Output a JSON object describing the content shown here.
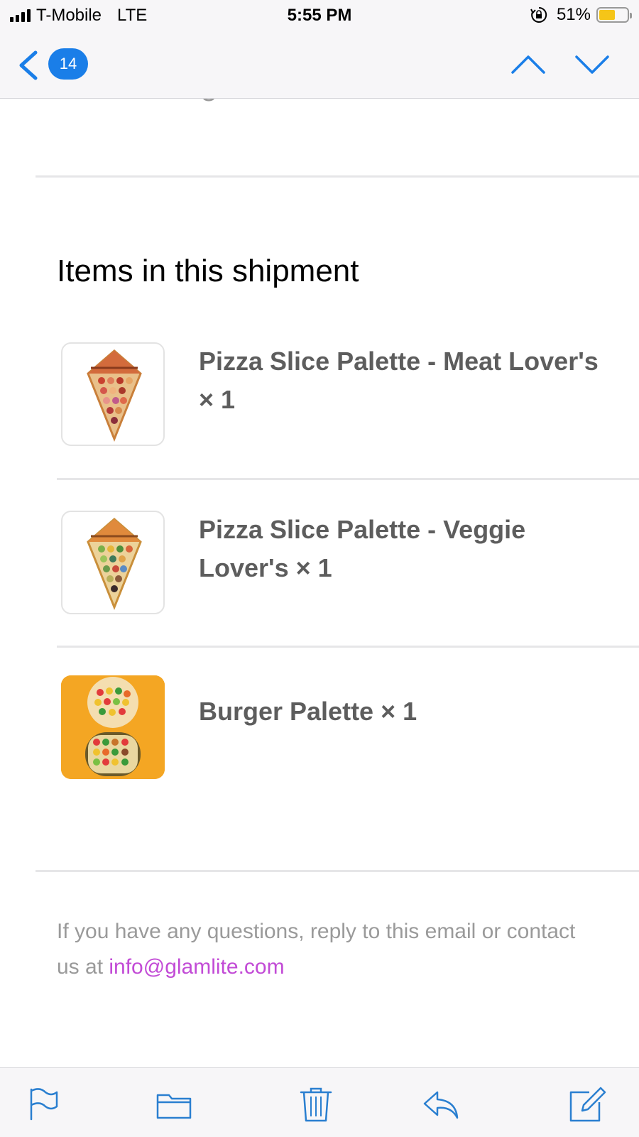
{
  "status_bar": {
    "carrier": "T-Mobile",
    "network": "LTE",
    "time": "5:55 PM",
    "battery_percent": "51%",
    "battery_level": 0.51,
    "icons": [
      "signal-icon",
      "orientation-lock-icon",
      "battery-icon"
    ]
  },
  "nav": {
    "unread_count": "14",
    "accent_color": "#1a7ee8",
    "icons": [
      "back-chevron-icon",
      "previous-message-icon",
      "next-message-icon"
    ]
  },
  "shipment": {
    "title": "Items in this shipment",
    "items": [
      {
        "name": "Pizza Slice Palette - Meat Lover's × 1",
        "thumbnail": "pizza-slice-meat-image"
      },
      {
        "name": "Pizza Slice Palette - Veggie Lover's × 1",
        "thumbnail": "pizza-slice-veggie-image"
      },
      {
        "name": "Burger Palette × 1",
        "thumbnail": "burger-palette-image"
      }
    ]
  },
  "footer": {
    "text": "If you have any questions, reply to this email or contact us at ",
    "email": "info@glamlite.com",
    "link_color": "#c24bd6"
  },
  "toolbar": {
    "icons": [
      "flag-icon",
      "folder-icon",
      "trash-icon",
      "reply-icon",
      "compose-icon"
    ]
  }
}
